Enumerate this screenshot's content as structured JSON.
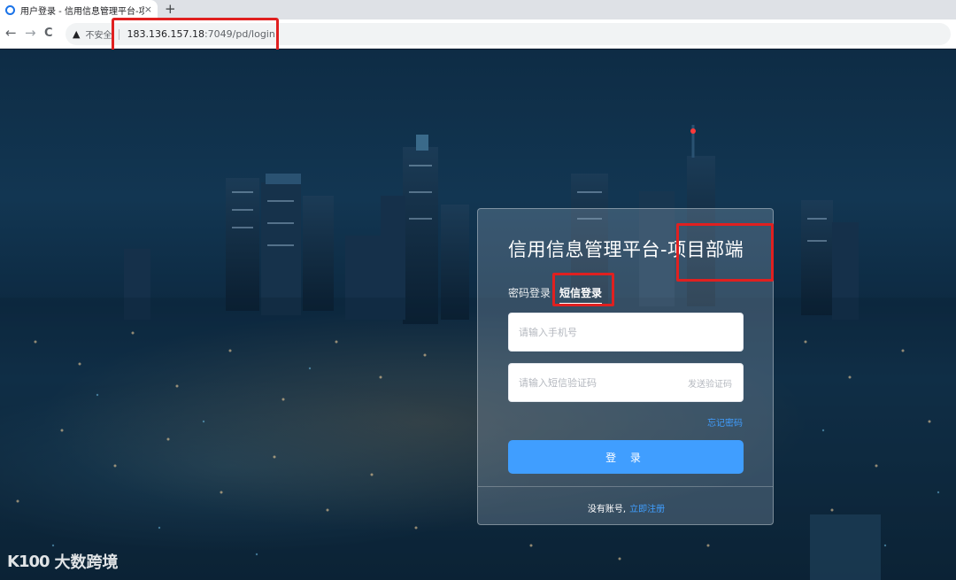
{
  "browser": {
    "tab_title": "用户登录 - 信用信息管理平台-项",
    "tab_close": "×",
    "new_tab": "+",
    "nav_back": "←",
    "nav_forward": "→",
    "nav_reload": "C",
    "security_icon": "warning-icon",
    "security_label": "不安全",
    "url_host": "183.136.157.18",
    "url_path": ":7049/pd/login"
  },
  "login": {
    "title": "信用信息管理平台-项目部端",
    "tabs": [
      "密码登录",
      "短信登录"
    ],
    "active_tab": "短信登录",
    "phone_placeholder": "请输入手机号",
    "code_placeholder": "请输入短信验证码",
    "send_code": "发送验证码",
    "forgot": "忘记密码",
    "submit": "登 录",
    "no_account": "没有账号,",
    "register": "立即注册"
  },
  "watermark": {
    "logo_text": "K100",
    "name": "大数跨境"
  },
  "colors": {
    "accent": "#409eff",
    "highlight": "#e02020"
  }
}
